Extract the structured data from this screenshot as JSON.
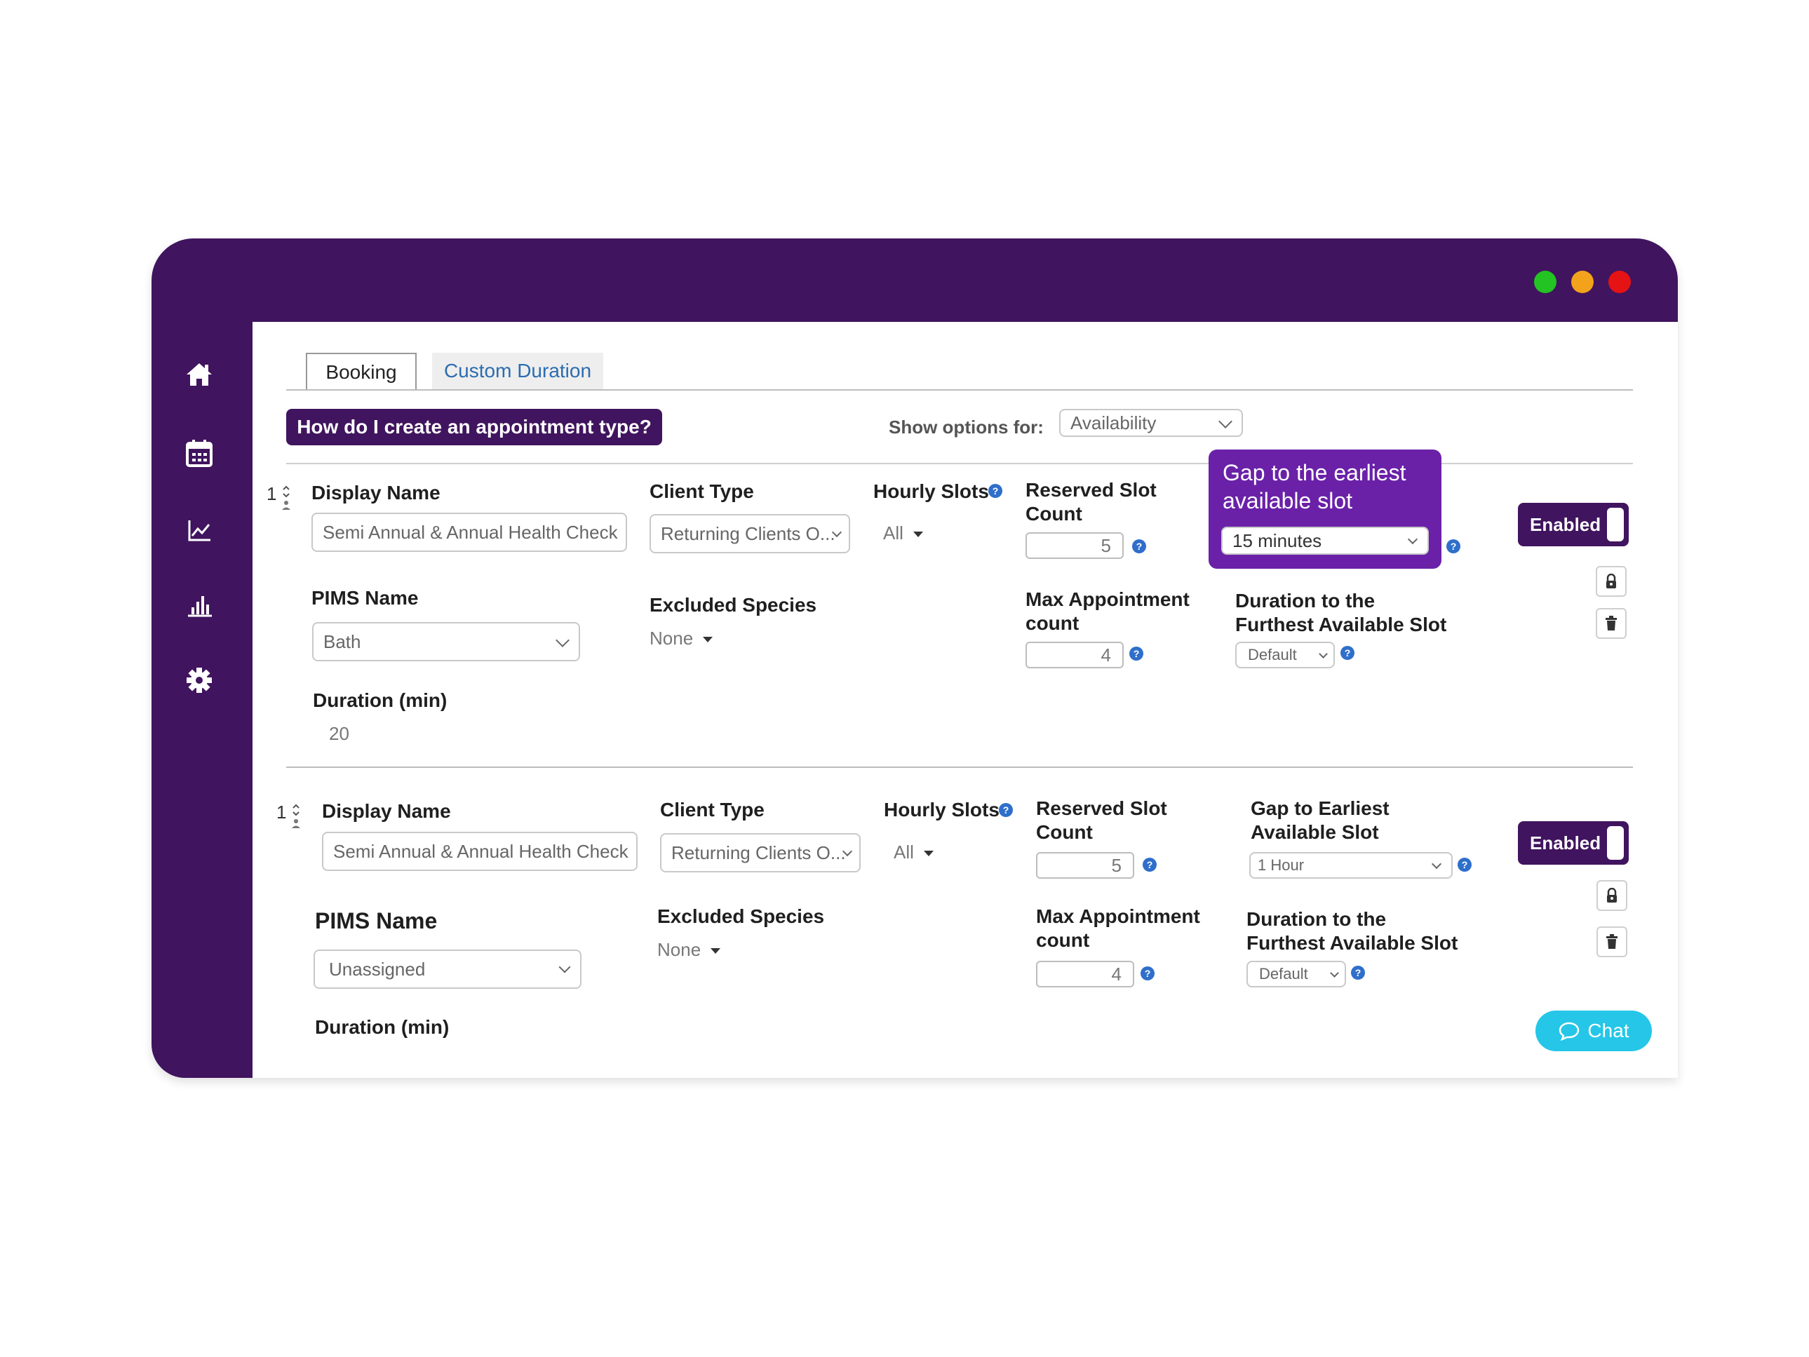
{
  "window": {
    "controls": {
      "green": "#22c322",
      "orange": "#f3a21b",
      "red": "#e51313"
    },
    "frame_color": "#40145e"
  },
  "sidebar": {
    "items": [
      {
        "icon": "home-icon"
      },
      {
        "icon": "calendar-icon"
      },
      {
        "icon": "line-chart-icon"
      },
      {
        "icon": "bar-chart-icon"
      },
      {
        "icon": "gear-icon"
      }
    ]
  },
  "tabs": [
    {
      "label": "Booking",
      "active": true
    },
    {
      "label": "Custom Duration",
      "active": false
    }
  ],
  "help_button": "How do I create an appointment type?",
  "show_options": {
    "label": "Show options for:",
    "value": "Availability"
  },
  "rows": [
    {
      "order": "1",
      "display_name_label": "Display Name",
      "display_name_value": "Semi Annual & Annual Health Check",
      "client_type_label": "Client Type",
      "client_type_value": "Returning Clients O...",
      "hourly_slots_label": "Hourly Slots",
      "hourly_slots_value": "All",
      "reserved_label_1": "Reserved Slot",
      "reserved_label_2": "Count",
      "reserved_value": "5",
      "gap_label_1": "Gap to the earliest",
      "gap_label_2": "available slot",
      "gap_value": "15 minutes",
      "status": "Enabled",
      "pims_label": "PIMS Name",
      "pims_value": "Bath",
      "excluded_label": "Excluded Species",
      "excluded_value": "None",
      "max_label_1": "Max Appointment",
      "max_label_2": "count",
      "max_value": "4",
      "furthest_label_1": "Duration to the",
      "furthest_label_2": "Furthest Available Slot",
      "furthest_value": "Default",
      "duration_label": "Duration (min)",
      "duration_value": "20"
    },
    {
      "order": "1",
      "display_name_label": "Display Name",
      "display_name_value": "Semi Annual & Annual Health Check",
      "client_type_label": "Client Type",
      "client_type_value": "Returning Clients O...",
      "hourly_slots_label": "Hourly Slots",
      "hourly_slots_value": "All",
      "reserved_label_1": "Reserved Slot",
      "reserved_label_2": "Count",
      "reserved_value": "5",
      "gap_label_1": "Gap to Earliest",
      "gap_label_2": "Available Slot",
      "gap_value": "1 Hour",
      "status": "Enabled",
      "pims_label": "PIMS Name",
      "pims_value": "Unassigned",
      "excluded_label": "Excluded Species",
      "excluded_value": "None",
      "max_label_1": "Max Appointment",
      "max_label_2": "count",
      "max_value": "4",
      "furthest_label_1": "Duration to the",
      "furthest_label_2": "Furthest Available Slot",
      "furthest_value": "Default",
      "duration_label": "Duration (min)"
    }
  ],
  "chat_button": "Chat",
  "help_icon_glyph": "?",
  "colors": {
    "accent": "#40145e",
    "highlight": "#6a21a8",
    "help_blue": "#2f6fcb",
    "chat": "#25c6e8",
    "tab_link": "#2b6cb0"
  }
}
